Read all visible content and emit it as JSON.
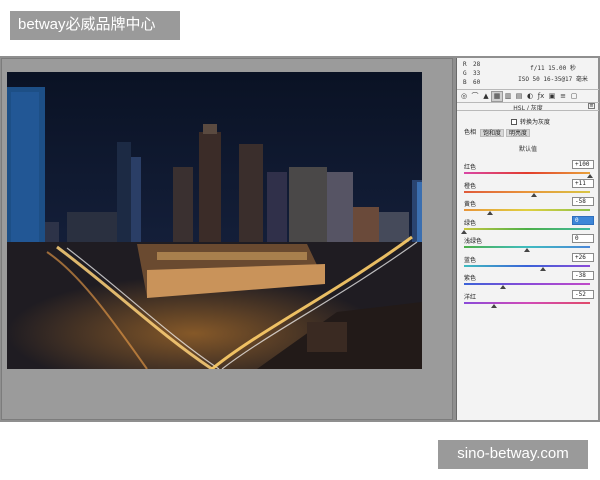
{
  "watermarks": {
    "top": "betway必威品牌中心",
    "bottom": "sino-betway.com"
  },
  "panel": {
    "readout": {
      "r_label": "R",
      "r_value": "28",
      "g_label": "G",
      "g_value": "33",
      "b_label": "B",
      "b_value": "60"
    },
    "exposure": {
      "line1": "f/11  15.00 秒",
      "line2": "ISO 50  16-35@17 毫米"
    },
    "tool_icons": [
      "aperture-icon",
      "curve-icon",
      "triangle-icon",
      "hsl-icon",
      "split-toning-icon",
      "detail-icon",
      "lens-icon",
      "fx-icon",
      "camera-icon",
      "presets-icon",
      "snapshot-icon"
    ],
    "tool_glyphs": [
      "◎",
      "⌒",
      "▲",
      "▦",
      "▥",
      "▤",
      "◐",
      "ƒx",
      "▣",
      "≡",
      "▢"
    ],
    "title": "HSL / 灰度",
    "menu_glyph": "≡",
    "grayscale_label": "转换为灰度",
    "subtabs": [
      "色相",
      "饱和度",
      "明亮度"
    ],
    "default_label": "默认值",
    "hsl_rows": [
      {
        "label": "红色",
        "value": "+100",
        "fraction": 1.0,
        "gradient": [
          "#d946a6",
          "#e23c2c",
          "#e8a23a"
        ]
      },
      {
        "label": "橙色",
        "value": "+11",
        "fraction": 0.555,
        "gradient": [
          "#e05a3a",
          "#e8953a",
          "#d8c545"
        ]
      },
      {
        "label": "黄色",
        "value": "-58",
        "fraction": 0.21,
        "gradient": [
          "#e8953a",
          "#e0d040",
          "#8cc24a"
        ]
      },
      {
        "label": "绿色",
        "value": "0",
        "fraction": 0.0,
        "gradient": [
          "#c8c840",
          "#4db048",
          "#3fb8a0"
        ],
        "selected": true
      },
      {
        "label": "浅绿色",
        "value": "0",
        "fraction": 0.5,
        "gradient": [
          "#4db048",
          "#3fbcc0",
          "#4a86d8"
        ]
      },
      {
        "label": "蓝色",
        "value": "+26",
        "fraction": 0.63,
        "gradient": [
          "#3fbcc0",
          "#3a62d8",
          "#8a4ad8"
        ]
      },
      {
        "label": "紫色",
        "value": "-38",
        "fraction": 0.31,
        "gradient": [
          "#3a62d8",
          "#8a4ad8",
          "#c04ac8"
        ]
      },
      {
        "label": "洋红",
        "value": "-52",
        "fraction": 0.24,
        "gradient": [
          "#8a4ad8",
          "#d04ab8",
          "#e04a6a"
        ]
      }
    ]
  },
  "photo": {
    "sky": "#0b1426",
    "glow": "#e8a040",
    "trail": "#ffd27a"
  }
}
